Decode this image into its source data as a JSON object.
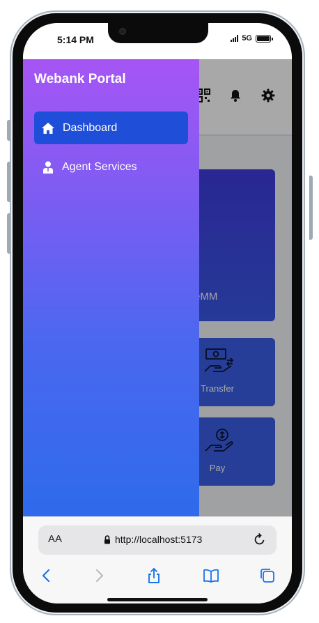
{
  "status_bar": {
    "time": "5:14 PM",
    "network": "5G"
  },
  "app": {
    "card_big_label": "eMM",
    "cards": [
      {
        "label": "Transfer",
        "icon": "money-transfer-icon"
      },
      {
        "label": "Pay",
        "icon": "pay-hand-coin-icon"
      }
    ],
    "header_icons": [
      "qr-code-icon",
      "bell-icon",
      "gear-icon"
    ]
  },
  "drawer": {
    "title": "Webank Portal",
    "items": [
      {
        "label": "Dashboard",
        "icon": "home-icon",
        "active": true
      },
      {
        "label": "Agent Services",
        "icon": "agent-user-icon",
        "active": false
      }
    ]
  },
  "browser": {
    "aa_label": "AA",
    "url": "http://localhost:5173",
    "toolbar": [
      "back-icon",
      "forward-icon",
      "share-icon",
      "bookmarks-icon",
      "tabs-icon"
    ]
  },
  "colors": {
    "drawer_top": "#a655f4",
    "drawer_bottom": "#2e6aeb",
    "active_item": "#1f4fd8",
    "browser_accent": "#1a73e8"
  }
}
